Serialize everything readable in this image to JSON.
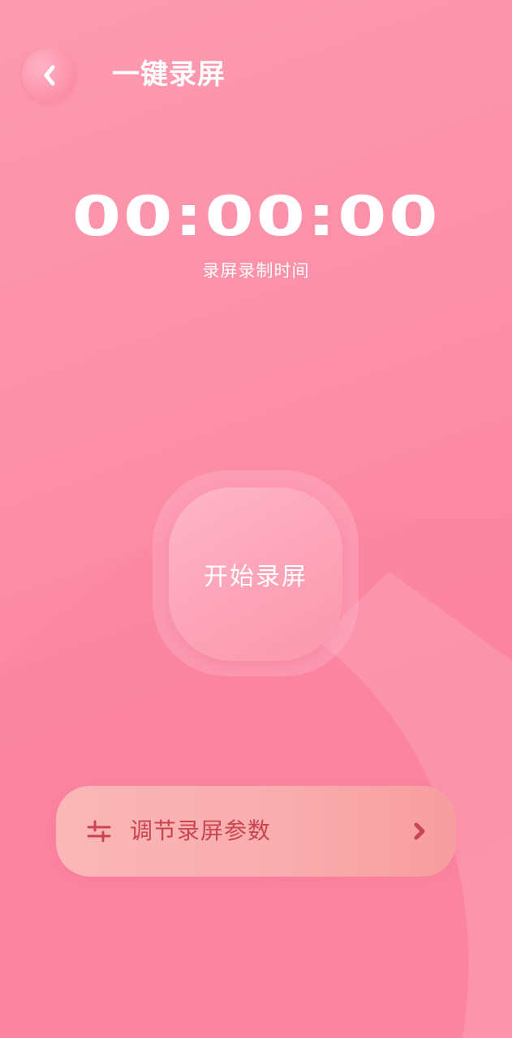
{
  "header": {
    "title": "一键录屏",
    "back_icon": "chevron-left-icon"
  },
  "timer": {
    "value": "00:00:00",
    "caption": "录屏录制时间"
  },
  "record": {
    "label": "开始录屏"
  },
  "settings": {
    "label": "调节录屏参数",
    "icon": "sliders-icon",
    "arrow_icon": "chevron-right-icon"
  },
  "colors": {
    "background": "#fc8ea8",
    "accent_text": "#c9454f",
    "settings_bar": "#f9adae",
    "white": "#ffffff"
  }
}
